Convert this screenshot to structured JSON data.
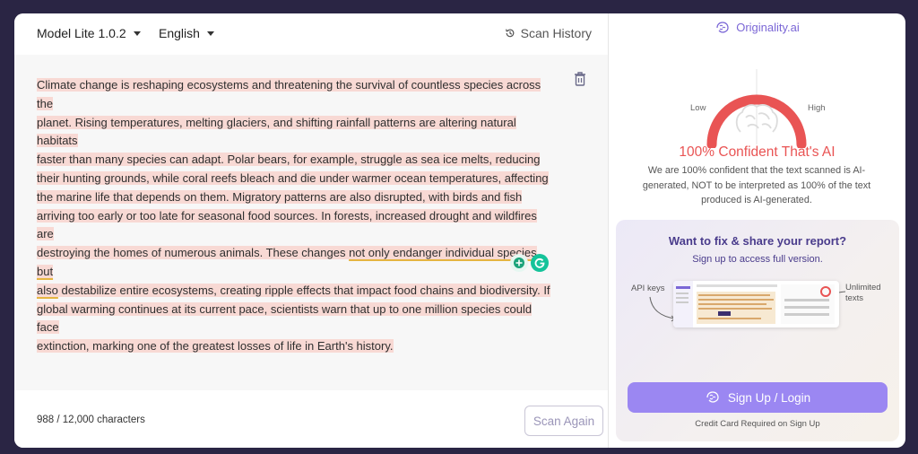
{
  "toolbar": {
    "model_label": "Model Lite 1.0.2",
    "language_label": "English",
    "scan_history_label": "Scan History"
  },
  "editor": {
    "lines": [
      "Climate change is reshaping ecosystems and threatening the survival of countless species across the",
      "planet. Rising temperatures, melting glaciers, and shifting rainfall patterns are altering natural habitats",
      "faster than many species can adapt. Polar bears, for example, struggle as sea ice melts, reducing",
      "their hunting grounds, while coral reefs bleach and die under warmer ocean temperatures, affecting",
      "the marine life that depends on them. Migratory patterns are also disrupted, with birds and fish",
      "arriving too early or too late for seasonal food sources. In forests, increased drought and wildfires are",
      "destroying the homes of numerous animals. These changes ",
      "not only endanger individual species but",
      "also",
      " destabilize entire ecosystems, creating ripple effects that impact food chains and biodiversity. If",
      "global warming continues at its current pace, scientists warn that up to one million species could face",
      "extinction, marking one of the greatest losses of life in Earth's history."
    ],
    "highlight_color": "#f8d9d4",
    "underline_color": "#e5b541"
  },
  "footer": {
    "char_count": "988 / 12,000 characters",
    "scan_again_label": "Scan Again"
  },
  "result": {
    "brand": "Originality.ai",
    "gauge_low": "Low",
    "gauge_high": "High",
    "confidence_percent": 100,
    "headline": "100% Confident That's AI",
    "description": "We are 100% confident that the text scanned is AI-generated, NOT to be interpreted as 100% of the text produced is AI-generated."
  },
  "promo": {
    "title": "Want to fix & share your report?",
    "subtitle": "Sign up to access full version.",
    "api_keys": "API keys",
    "unlimited": "Unlimited texts",
    "signup_label": "Sign Up / Login",
    "cc_note": "Credit Card Required on Sign Up"
  },
  "colors": {
    "accent": "#9b87f2",
    "brand": "#7b67d6",
    "danger": "#e95454",
    "background": "#2a2544"
  }
}
